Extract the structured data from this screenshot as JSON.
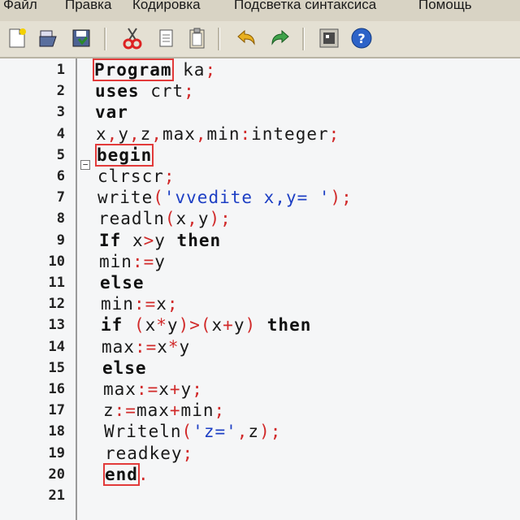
{
  "menu": [
    "Файл",
    "Правка",
    "Кодировка",
    "Подсветка синтаксиса",
    "Помощь"
  ],
  "toolbar": {
    "buttons": [
      {
        "name": "new-file-icon"
      },
      {
        "name": "open-file-icon"
      },
      {
        "name": "save-file-icon"
      },
      {
        "name": "cut-icon"
      },
      {
        "name": "copy-icon"
      },
      {
        "name": "paste-icon"
      },
      {
        "name": "undo-icon"
      },
      {
        "name": "redo-icon"
      },
      {
        "name": "run-icon"
      },
      {
        "name": "help-icon"
      }
    ]
  },
  "editor": {
    "lines": [
      {
        "n": "1",
        "tokens": [
          [
            "kw boxed",
            "Program"
          ],
          [
            "",
            " ka"
          ],
          [
            "op",
            ";"
          ]
        ]
      },
      {
        "n": "2",
        "tokens": [
          [
            "kw",
            "uses"
          ],
          [
            "",
            " crt"
          ],
          [
            "op",
            ";"
          ]
        ]
      },
      {
        "n": "3",
        "tokens": [
          [
            "kw",
            "var"
          ]
        ]
      },
      {
        "n": "4",
        "tokens": [
          [
            "",
            "x"
          ],
          [
            "op",
            ","
          ],
          [
            "",
            "y"
          ],
          [
            "op",
            ","
          ],
          [
            "",
            "z"
          ],
          [
            "op",
            ","
          ],
          [
            "",
            "max"
          ],
          [
            "op",
            ","
          ],
          [
            "",
            "min"
          ],
          [
            "op",
            ":"
          ],
          [
            "",
            "integer"
          ],
          [
            "op",
            ";"
          ]
        ]
      },
      {
        "n": "5",
        "tokens": [
          [
            "kw boxed",
            "begin"
          ]
        ]
      },
      {
        "n": "6",
        "tokens": [
          [
            "",
            "clrscr"
          ],
          [
            "op",
            ";"
          ]
        ]
      },
      {
        "n": "7",
        "tokens": [
          [
            "",
            "write"
          ],
          [
            "op",
            "("
          ],
          [
            "str",
            "'vvedite x,y= '"
          ],
          [
            "op",
            ");"
          ]
        ]
      },
      {
        "n": "8",
        "tokens": [
          [
            "",
            "readln"
          ],
          [
            "op",
            "("
          ],
          [
            "",
            "x"
          ],
          [
            "op",
            ","
          ],
          [
            "",
            "y"
          ],
          [
            "op",
            ");"
          ]
        ]
      },
      {
        "n": "9",
        "tokens": [
          [
            "kw",
            "If"
          ],
          [
            "",
            " x"
          ],
          [
            "op",
            ">"
          ],
          [
            "",
            "y "
          ],
          [
            "kw",
            "then"
          ]
        ]
      },
      {
        "n": "10",
        "tokens": [
          [
            "",
            "min"
          ],
          [
            "op",
            ":="
          ],
          [
            "",
            "y"
          ]
        ]
      },
      {
        "n": "11",
        "tokens": [
          [
            "kw",
            "else"
          ]
        ]
      },
      {
        "n": "12",
        "tokens": [
          [
            "",
            "min"
          ],
          [
            "op",
            ":="
          ],
          [
            "",
            "x"
          ],
          [
            "op",
            ";"
          ]
        ]
      },
      {
        "n": "13",
        "tokens": [
          [
            "kw",
            "if"
          ],
          [
            "op",
            " ("
          ],
          [
            "",
            "x"
          ],
          [
            "op",
            "*"
          ],
          [
            "",
            "y"
          ],
          [
            "op",
            ")>("
          ],
          [
            "",
            "x"
          ],
          [
            "op",
            "+"
          ],
          [
            "",
            "y"
          ],
          [
            "op",
            ")"
          ],
          [
            "",
            " "
          ],
          [
            "kw",
            "then"
          ]
        ]
      },
      {
        "n": "14",
        "tokens": [
          [
            "",
            "max"
          ],
          [
            "op",
            ":="
          ],
          [
            "",
            "x"
          ],
          [
            "op",
            "*"
          ],
          [
            "",
            "y"
          ]
        ]
      },
      {
        "n": "15",
        "tokens": [
          [
            "kw",
            "else"
          ]
        ]
      },
      {
        "n": "16",
        "tokens": [
          [
            "",
            "max"
          ],
          [
            "op",
            ":="
          ],
          [
            "",
            "x"
          ],
          [
            "op",
            "+"
          ],
          [
            "",
            "y"
          ],
          [
            "op",
            ";"
          ]
        ]
      },
      {
        "n": "17",
        "tokens": [
          [
            "",
            "z"
          ],
          [
            "op",
            ":="
          ],
          [
            "",
            "max"
          ],
          [
            "op",
            "+"
          ],
          [
            "",
            "min"
          ],
          [
            "op",
            ";"
          ]
        ]
      },
      {
        "n": "18",
        "tokens": [
          [
            "",
            "Writeln"
          ],
          [
            "op",
            "("
          ],
          [
            "str",
            "'z='"
          ],
          [
            "op",
            ","
          ],
          [
            "",
            "z"
          ],
          [
            "op",
            ");"
          ]
        ]
      },
      {
        "n": "19",
        "tokens": [
          [
            "",
            "readkey"
          ],
          [
            "op",
            ";"
          ]
        ]
      },
      {
        "n": "20",
        "tokens": [
          [
            "kw boxed",
            "end"
          ],
          [
            "op",
            "."
          ]
        ]
      },
      {
        "n": "21",
        "tokens": []
      }
    ]
  }
}
